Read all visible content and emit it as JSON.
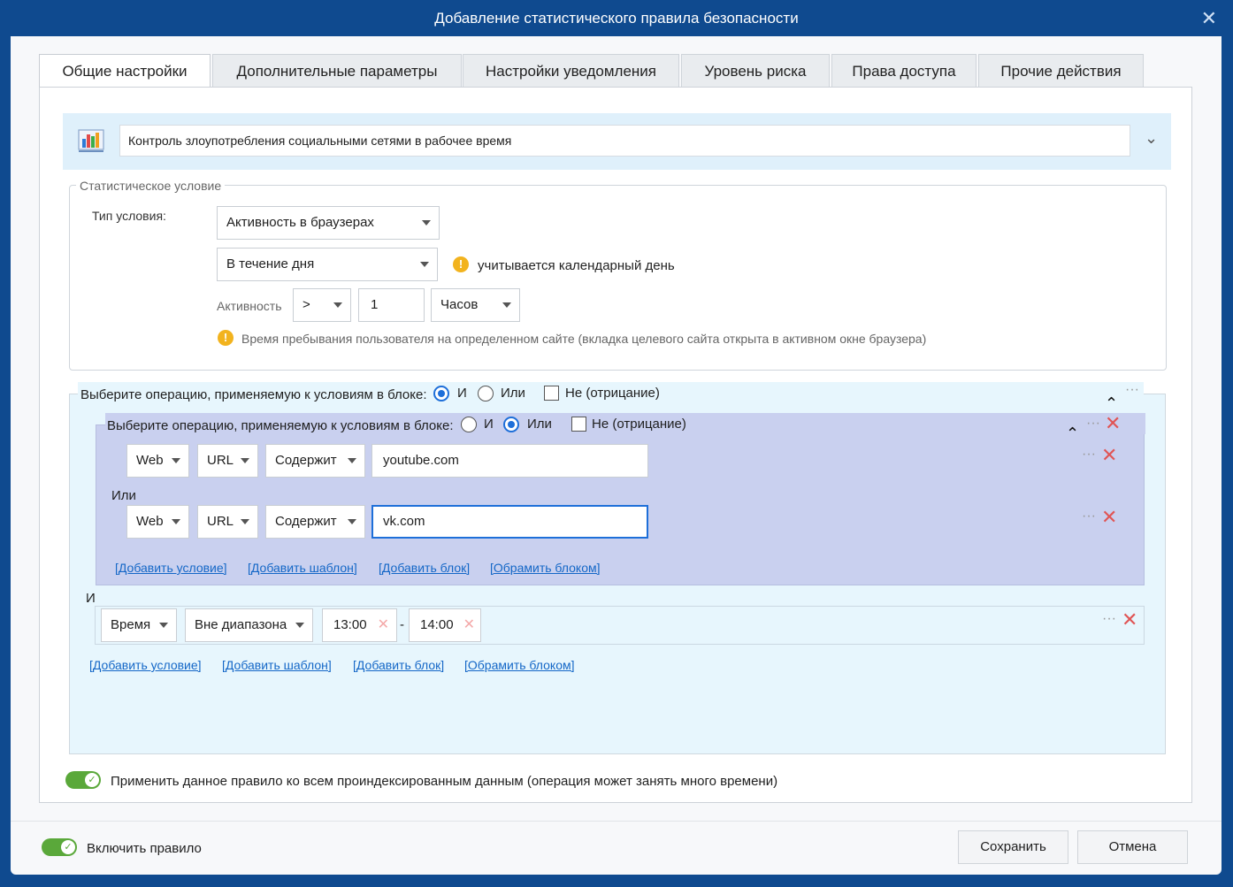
{
  "window": {
    "title": "Добавление статистического правила безопасности",
    "close_glyph": "✕"
  },
  "tabs": [
    {
      "label": "Общие настройки",
      "active": true
    },
    {
      "label": "Дополнительные параметры"
    },
    {
      "label": "Настройки уведомления"
    },
    {
      "label": "Уровень риска"
    },
    {
      "label": "Права доступа"
    },
    {
      "label": "Прочие действия"
    }
  ],
  "rule": {
    "name": "Контроль злоупотребления социальными сетями в рабочее время",
    "icon": "bar-chart-icon"
  },
  "stat_condition": {
    "legend": "Статистическое условие",
    "type_label": "Тип условия:",
    "type_value": "Активность в браузерах",
    "period_value": "В течение дня",
    "period_hint": "учитывается календарный день",
    "activity_label": "Активность",
    "operator": ">",
    "amount": "1",
    "unit": "Часов",
    "note": "Время пребывания пользователя на определенном сайте (вкладка целевого сайта открыта в активном окне браузера)"
  },
  "outer_block": {
    "op_label": "Выберите операцию, применяемую к условиям в блоке:",
    "and": "И",
    "or": "Или",
    "not": "Не (отрицание)",
    "selected": "and",
    "not_checked": false,
    "joiner": "И"
  },
  "inner_block": {
    "op_label": "Выберите операцию, применяемую к условиям в блоке:",
    "and": "И",
    "or": "Или",
    "not": "Не (отрицание)",
    "selected": "or",
    "not_checked": false,
    "joiner": "Или",
    "conditions": [
      {
        "source": "Web",
        "field": "URL",
        "op": "Содержит",
        "value": "youtube.com"
      },
      {
        "source": "Web",
        "field": "URL",
        "op": "Содержит",
        "value": "vk.com"
      }
    ]
  },
  "time_condition": {
    "type": "Время",
    "mode": "Вне диапазона",
    "from": "13:00",
    "dash": "-",
    "to": "14:00"
  },
  "links": {
    "add_condition": "[Добавить условие]",
    "add_template": "[Добавить шаблон]",
    "add_block": "[Добавить блок]",
    "wrap_block": "[Обрамить блоком]"
  },
  "glyphs": {
    "dots": "···",
    "close": "✕",
    "caret_up": "⌃",
    "chevron_down": "⌄",
    "warn": "!",
    "check": "✓"
  },
  "apply_all": {
    "label": "Применить данное правило ко всем проиндексированным данным (операция может занять много времени)",
    "on": true
  },
  "enable_rule": {
    "label": "Включить правило",
    "on": true
  },
  "buttons": {
    "save": "Сохранить",
    "cancel": "Отмена"
  },
  "colors": {
    "titlebar": "#0f4a8f",
    "accent": "#1e6fd9",
    "inner_block": "#c9d0ef",
    "outer_block": "#e7f6fd",
    "toggle": "#5aa83a"
  }
}
